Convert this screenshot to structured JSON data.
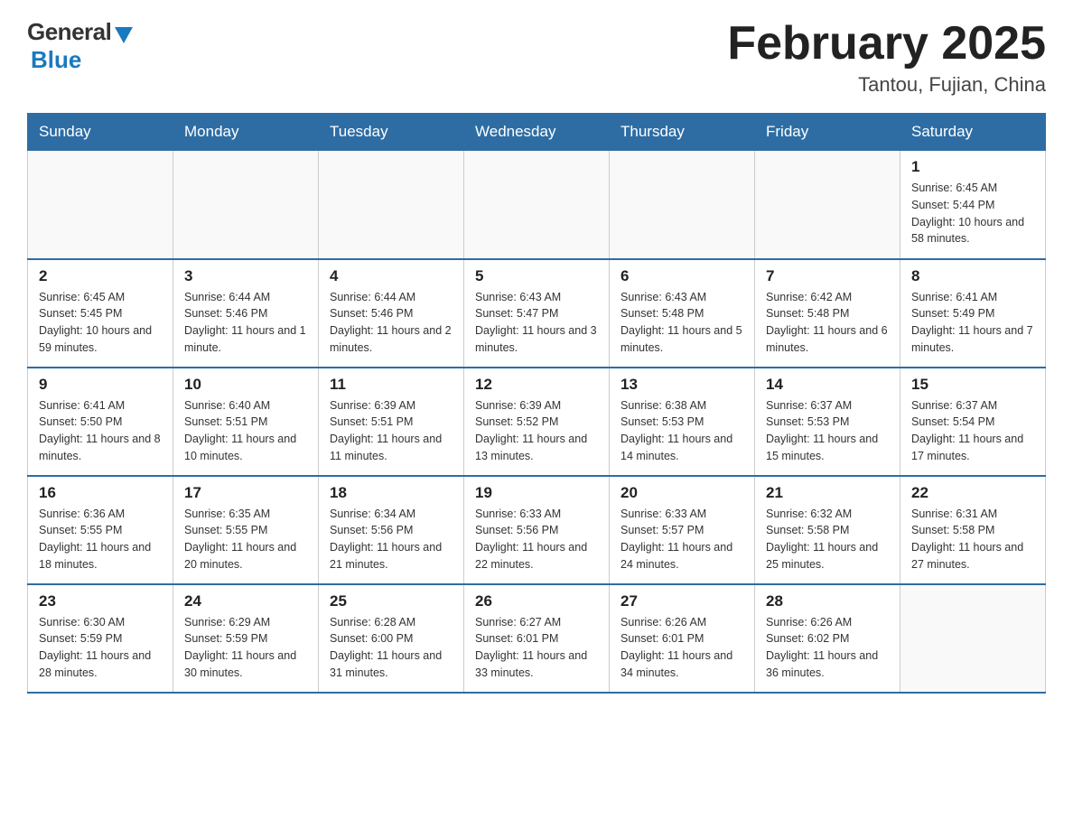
{
  "header": {
    "logo_general": "General",
    "logo_blue": "Blue",
    "title": "February 2025",
    "subtitle": "Tantou, Fujian, China"
  },
  "days_of_week": [
    "Sunday",
    "Monday",
    "Tuesday",
    "Wednesday",
    "Thursday",
    "Friday",
    "Saturday"
  ],
  "weeks": [
    [
      {
        "day": "",
        "info": ""
      },
      {
        "day": "",
        "info": ""
      },
      {
        "day": "",
        "info": ""
      },
      {
        "day": "",
        "info": ""
      },
      {
        "day": "",
        "info": ""
      },
      {
        "day": "",
        "info": ""
      },
      {
        "day": "1",
        "info": "Sunrise: 6:45 AM\nSunset: 5:44 PM\nDaylight: 10 hours and 58 minutes."
      }
    ],
    [
      {
        "day": "2",
        "info": "Sunrise: 6:45 AM\nSunset: 5:45 PM\nDaylight: 10 hours and 59 minutes."
      },
      {
        "day": "3",
        "info": "Sunrise: 6:44 AM\nSunset: 5:46 PM\nDaylight: 11 hours and 1 minute."
      },
      {
        "day": "4",
        "info": "Sunrise: 6:44 AM\nSunset: 5:46 PM\nDaylight: 11 hours and 2 minutes."
      },
      {
        "day": "5",
        "info": "Sunrise: 6:43 AM\nSunset: 5:47 PM\nDaylight: 11 hours and 3 minutes."
      },
      {
        "day": "6",
        "info": "Sunrise: 6:43 AM\nSunset: 5:48 PM\nDaylight: 11 hours and 5 minutes."
      },
      {
        "day": "7",
        "info": "Sunrise: 6:42 AM\nSunset: 5:48 PM\nDaylight: 11 hours and 6 minutes."
      },
      {
        "day": "8",
        "info": "Sunrise: 6:41 AM\nSunset: 5:49 PM\nDaylight: 11 hours and 7 minutes."
      }
    ],
    [
      {
        "day": "9",
        "info": "Sunrise: 6:41 AM\nSunset: 5:50 PM\nDaylight: 11 hours and 8 minutes."
      },
      {
        "day": "10",
        "info": "Sunrise: 6:40 AM\nSunset: 5:51 PM\nDaylight: 11 hours and 10 minutes."
      },
      {
        "day": "11",
        "info": "Sunrise: 6:39 AM\nSunset: 5:51 PM\nDaylight: 11 hours and 11 minutes."
      },
      {
        "day": "12",
        "info": "Sunrise: 6:39 AM\nSunset: 5:52 PM\nDaylight: 11 hours and 13 minutes."
      },
      {
        "day": "13",
        "info": "Sunrise: 6:38 AM\nSunset: 5:53 PM\nDaylight: 11 hours and 14 minutes."
      },
      {
        "day": "14",
        "info": "Sunrise: 6:37 AM\nSunset: 5:53 PM\nDaylight: 11 hours and 15 minutes."
      },
      {
        "day": "15",
        "info": "Sunrise: 6:37 AM\nSunset: 5:54 PM\nDaylight: 11 hours and 17 minutes."
      }
    ],
    [
      {
        "day": "16",
        "info": "Sunrise: 6:36 AM\nSunset: 5:55 PM\nDaylight: 11 hours and 18 minutes."
      },
      {
        "day": "17",
        "info": "Sunrise: 6:35 AM\nSunset: 5:55 PM\nDaylight: 11 hours and 20 minutes."
      },
      {
        "day": "18",
        "info": "Sunrise: 6:34 AM\nSunset: 5:56 PM\nDaylight: 11 hours and 21 minutes."
      },
      {
        "day": "19",
        "info": "Sunrise: 6:33 AM\nSunset: 5:56 PM\nDaylight: 11 hours and 22 minutes."
      },
      {
        "day": "20",
        "info": "Sunrise: 6:33 AM\nSunset: 5:57 PM\nDaylight: 11 hours and 24 minutes."
      },
      {
        "day": "21",
        "info": "Sunrise: 6:32 AM\nSunset: 5:58 PM\nDaylight: 11 hours and 25 minutes."
      },
      {
        "day": "22",
        "info": "Sunrise: 6:31 AM\nSunset: 5:58 PM\nDaylight: 11 hours and 27 minutes."
      }
    ],
    [
      {
        "day": "23",
        "info": "Sunrise: 6:30 AM\nSunset: 5:59 PM\nDaylight: 11 hours and 28 minutes."
      },
      {
        "day": "24",
        "info": "Sunrise: 6:29 AM\nSunset: 5:59 PM\nDaylight: 11 hours and 30 minutes."
      },
      {
        "day": "25",
        "info": "Sunrise: 6:28 AM\nSunset: 6:00 PM\nDaylight: 11 hours and 31 minutes."
      },
      {
        "day": "26",
        "info": "Sunrise: 6:27 AM\nSunset: 6:01 PM\nDaylight: 11 hours and 33 minutes."
      },
      {
        "day": "27",
        "info": "Sunrise: 6:26 AM\nSunset: 6:01 PM\nDaylight: 11 hours and 34 minutes."
      },
      {
        "day": "28",
        "info": "Sunrise: 6:26 AM\nSunset: 6:02 PM\nDaylight: 11 hours and 36 minutes."
      },
      {
        "day": "",
        "info": ""
      }
    ]
  ]
}
